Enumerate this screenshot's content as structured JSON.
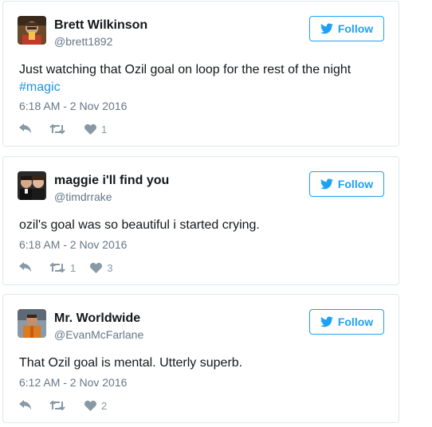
{
  "tweets": [
    {
      "name": "Brett Wilkinson",
      "handle": "@brett1892",
      "text": "Just watching that Ozil goal on loop for the rest of the night",
      "hashtag": "#magic",
      "time": "6:18 AM - 2 Nov 2016",
      "follow_label": "Follow",
      "retweets": "",
      "likes": "1"
    },
    {
      "name": "maggie i'll find you",
      "handle": "@timdrrake",
      "text": "ozil's goal was so beautiful i started crying.",
      "hashtag": "",
      "time": "6:18 AM - 2 Nov 2016",
      "follow_label": "Follow",
      "retweets": "1",
      "likes": "3"
    },
    {
      "name": "Mr. Worldwide",
      "handle": "@EvanMcFarlane",
      "text": "That Ozil goal is mental. Utterly superb.",
      "hashtag": "",
      "time": "6:12 AM - 2 Nov 2016",
      "follow_label": "Follow",
      "retweets": "",
      "likes": "2"
    }
  ],
  "icons": {
    "follow": "twitter-bird-icon",
    "reply": "reply-icon",
    "retweet": "retweet-icon",
    "like": "heart-icon"
  },
  "colors": {
    "accent": "#1da1f2",
    "hashtag": "#1b95e0",
    "muted": "#657786",
    "action": "#8899a6",
    "border": "#e1e8ed"
  }
}
